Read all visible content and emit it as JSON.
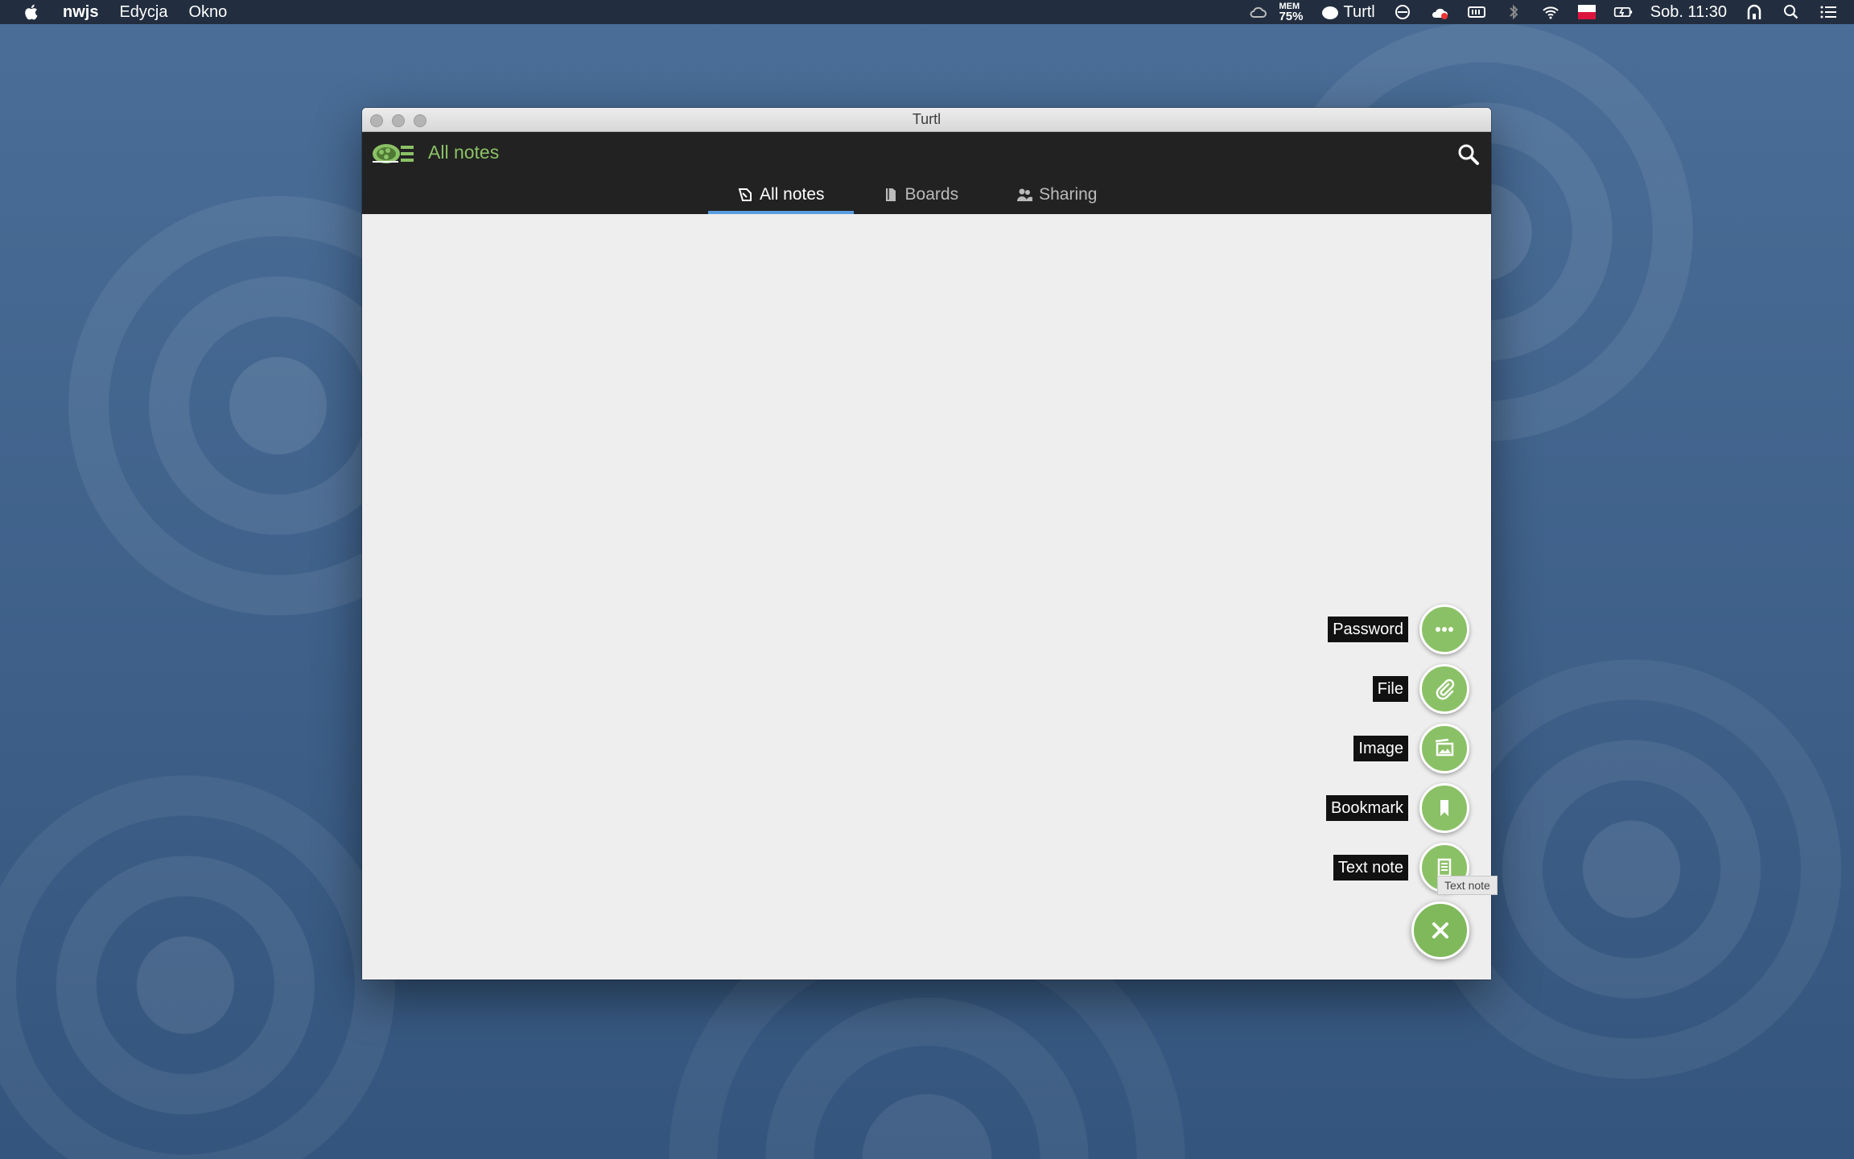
{
  "menubar": {
    "app_name": "nwjs",
    "menus": [
      "Edycja",
      "Okno"
    ],
    "status": {
      "mem_label": "MEM",
      "mem_value": "75%",
      "turtl_label": "Turtl",
      "clock": "Sob. 11:30"
    }
  },
  "window": {
    "title": "Turtl"
  },
  "header": {
    "title": "All notes",
    "accent_color": "#8bc166"
  },
  "tabs": [
    {
      "label": "All notes",
      "icon": "notes-icon",
      "active": true
    },
    {
      "label": "Boards",
      "icon": "boards-icon",
      "active": false
    },
    {
      "label": "Sharing",
      "icon": "sharing-icon",
      "active": false
    }
  ],
  "fab_menu": {
    "items": [
      {
        "label": "Password",
        "icon": "more-icon"
      },
      {
        "label": "File",
        "icon": "paperclip-icon"
      },
      {
        "label": "Image",
        "icon": "image-icon"
      },
      {
        "label": "Bookmark",
        "icon": "bookmark-icon"
      },
      {
        "label": "Text note",
        "icon": "text-note-icon"
      }
    ],
    "close_icon": "close-icon",
    "tooltip": "Text note",
    "button_color": "#8bc166"
  }
}
